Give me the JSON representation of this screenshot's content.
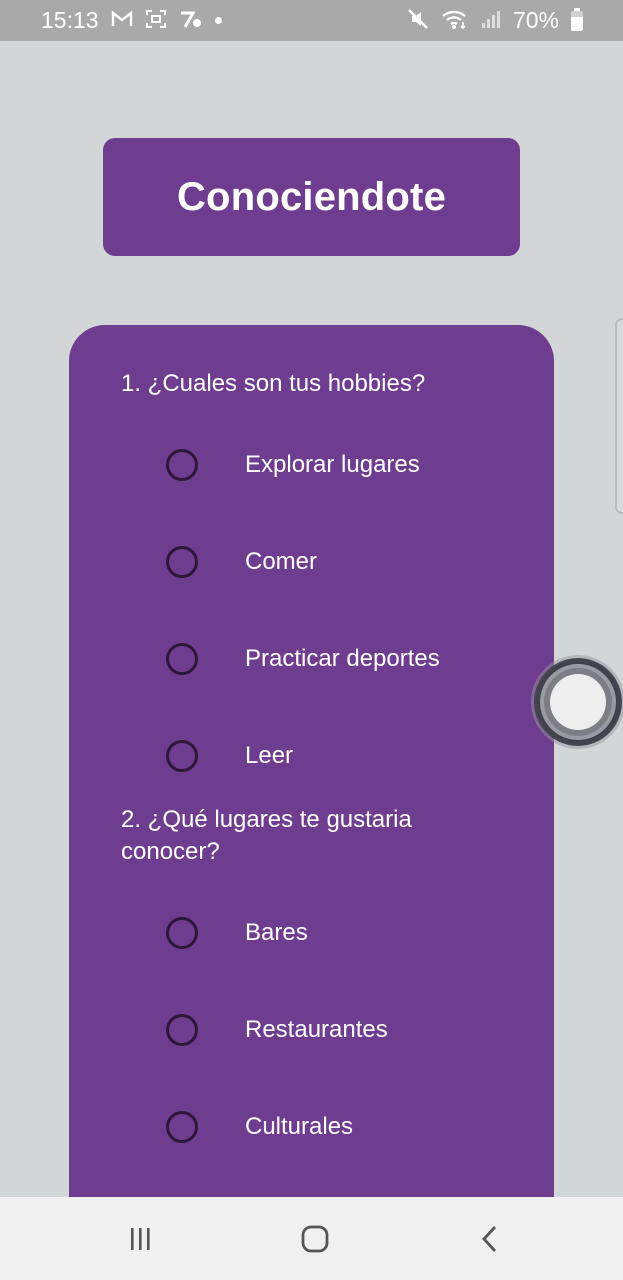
{
  "status_bar": {
    "time": "15:13",
    "battery": "70%",
    "battery_level": 0.7
  },
  "title": "Conociendote",
  "questions": [
    {
      "text": "1. ¿Cuales son tus hobbies?",
      "options": [
        "Explorar lugares",
        "Comer",
        "Practicar deportes",
        "Leer"
      ]
    },
    {
      "text": "2. ¿Qué lugares te gustaria conocer?",
      "options": [
        "Bares",
        "Restaurantes",
        "Culturales"
      ]
    }
  ],
  "colors": {
    "accent": "#6f3d8f",
    "background": "#d3d6d7",
    "radio_border": "#2b1838"
  },
  "icons": {
    "status_left": [
      "gmail-icon",
      "screenshot-icon",
      "app-notification-icon",
      "dot-icon"
    ],
    "status_right": [
      "mute-icon",
      "wifi-icon",
      "signal-icon",
      "battery-icon"
    ],
    "nav": [
      "recent-apps-icon",
      "home-icon",
      "back-icon"
    ]
  }
}
